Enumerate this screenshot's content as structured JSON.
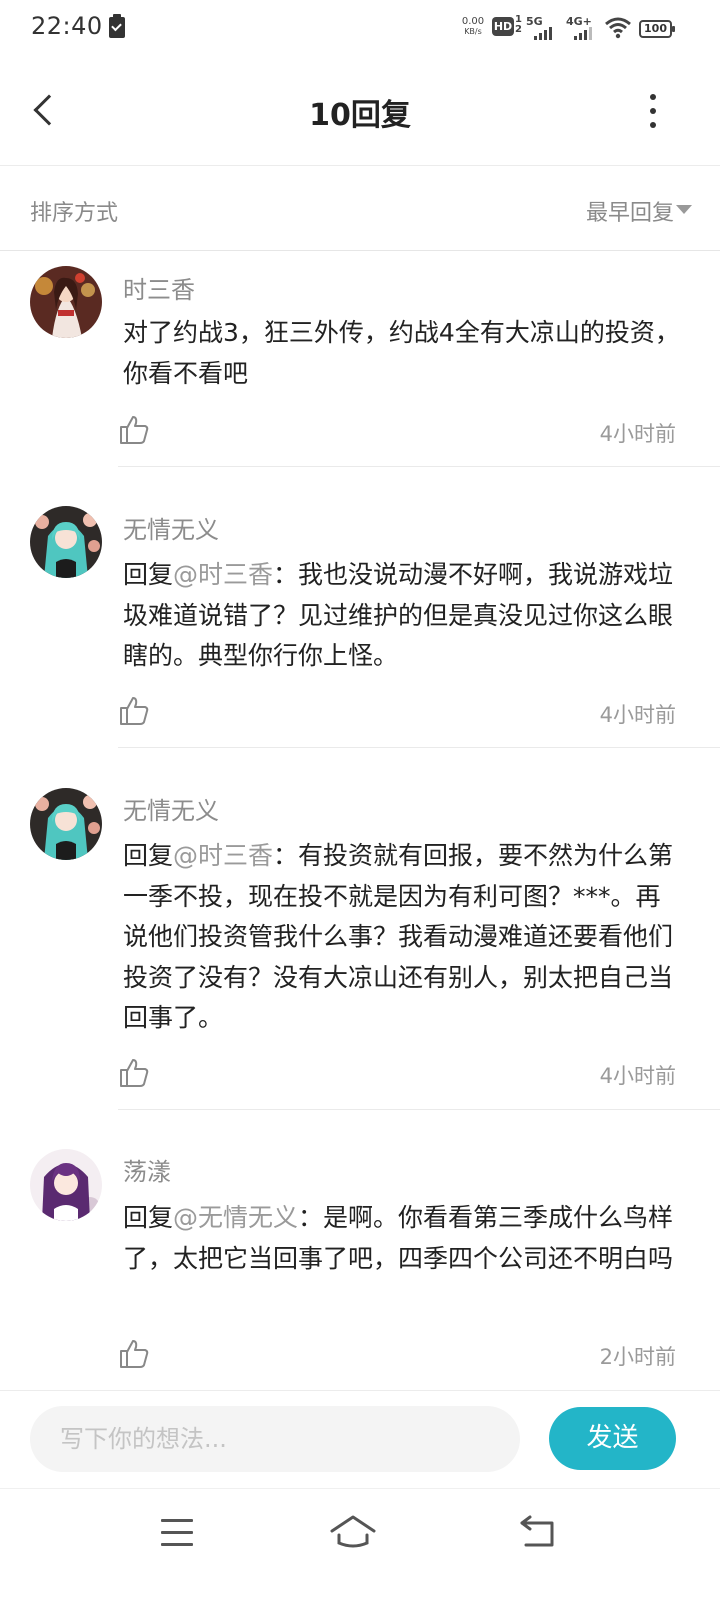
{
  "status_bar": {
    "time": "22:40",
    "net_speed_value": "0.00",
    "net_speed_unit": "KB/s",
    "hd_label": "HD",
    "hd_sub": "1\n2",
    "sim1_label": "5G",
    "sim2_label": "4G+",
    "battery": "100"
  },
  "header": {
    "title": "10回复"
  },
  "sort": {
    "label": "排序方式",
    "selected": "最早回复"
  },
  "comments": [
    {
      "user": "时三香",
      "prefix": "",
      "mention": "",
      "text": "对了约战3，狂三外传，约战4全有大凉山的投资，你看不看吧",
      "time": "4小时前"
    },
    {
      "user": "无情无义",
      "prefix": "回复",
      "mention": "@时三香",
      "text": "：我也没说动漫不好啊，我说游戏垃圾难道说错了？见过维护的但是真没见过你这么眼瞎的。典型你行你上怪。",
      "time": "4小时前"
    },
    {
      "user": "无情无义",
      "prefix": "回复",
      "mention": "@时三香",
      "text": "：有投资就有回报，要不然为什么第一季不投，现在投不就是因为有利可图？***。再说他们投资管我什么事？我看动漫难道还要看他们投资了没有？没有大凉山还有别人，别太把自己当回事了。",
      "time": "4小时前"
    },
    {
      "user": "荡漾",
      "prefix": "回复",
      "mention": "@无情无义",
      "text": "：是啊。你看看第三季成什么鸟样了，太把它当回事了吧，四季四个公司还不明白吗",
      "time": "2小时前"
    }
  ],
  "composer": {
    "placeholder": "写下你的想法...",
    "send_label": "发送"
  },
  "colors": {
    "accent": "#23b5c8",
    "muted_text": "#8c8c8c",
    "body_text": "#222222"
  },
  "icons": {
    "back": "chevron-left-icon",
    "more": "more-vertical-icon",
    "like": "thumbs-up-icon",
    "sort_caret": "caret-down-icon",
    "nav_menu": "menu-icon",
    "nav_home": "home-icon",
    "nav_back": "return-icon"
  }
}
